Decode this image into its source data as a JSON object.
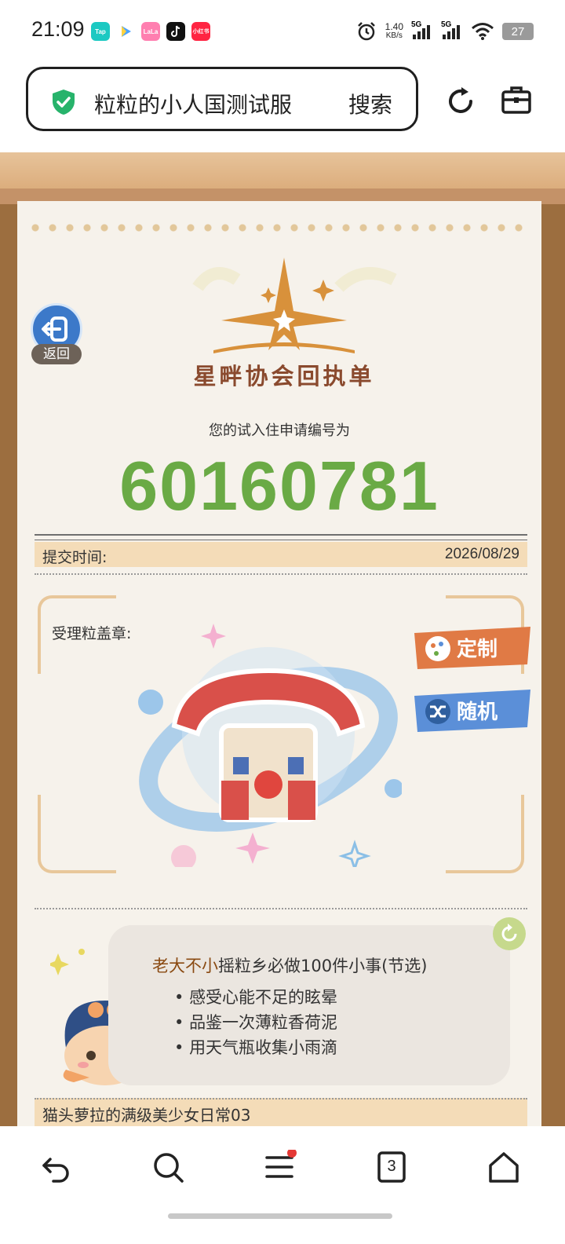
{
  "status_bar": {
    "time": "21:09",
    "app_icons": [
      "Tap",
      "video-play-icon",
      "LaLa",
      "tiktok-icon",
      "小红书"
    ],
    "net_speed_value": "1.40",
    "net_speed_unit": "KB/s",
    "signal1_label": "5G",
    "signal2_label": "5G",
    "battery": "27"
  },
  "browser": {
    "search_text": "粒粒的小人国测试服",
    "search_button": "搜索",
    "icons": [
      "shield-check-icon",
      "reload-icon",
      "toolbox-icon"
    ]
  },
  "page": {
    "back_label": "返回",
    "logo_title": "星畔协会回执单",
    "subtitle": "您的试入住申请编号为",
    "application_number": "60160781",
    "submit_time_label": "提交时间:",
    "submit_time_value": "2026/08/29",
    "stamp_label": "受理粒盖章:",
    "custom_button": "定制",
    "random_button": "随机",
    "card": {
      "title_highlight": "老大不小",
      "title_rest": "摇粒乡必做100件小事(节选)",
      "items": [
        "感受心能不足的眩晕",
        "品鉴一次薄粒香荷泥",
        "用天气瓶收集小雨滴"
      ]
    },
    "bottom_label": "猫头萝拉的满级美少女日常03"
  },
  "nav": {
    "tab_count": "3",
    "icons": [
      "back-arrow-icon",
      "search-icon",
      "menu-icon",
      "tabs-icon",
      "home-icon"
    ]
  },
  "colors": {
    "accent_green": "#6aaa45",
    "button_orange": "#e07a45",
    "button_blue": "#5b8fd8",
    "nav_badge": "#e53935"
  }
}
